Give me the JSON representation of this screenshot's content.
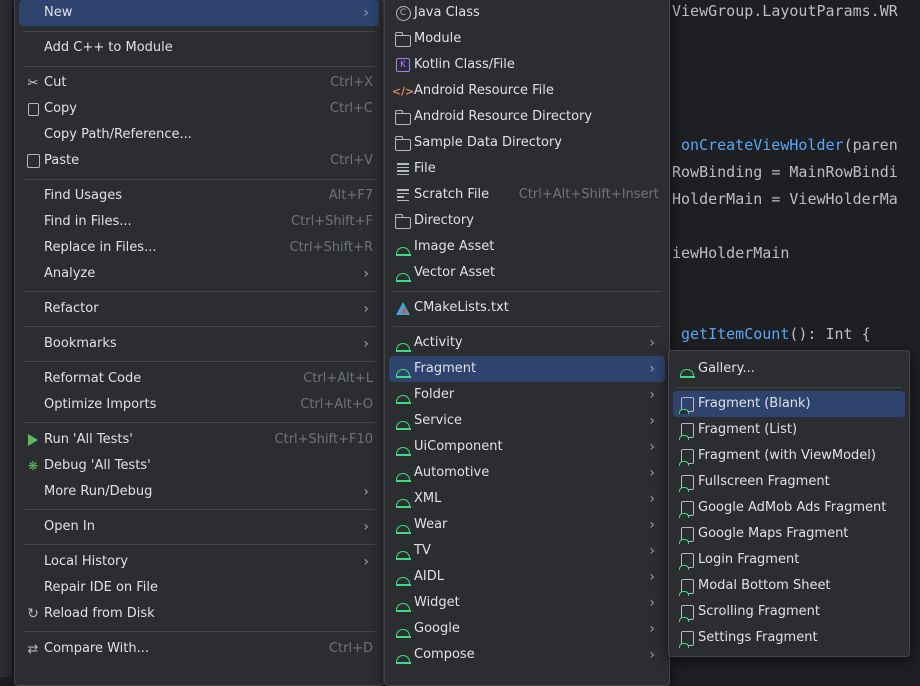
{
  "editor": {
    "lines": [
      {
        "text": "ViewGroup.LayoutParams.WR",
        "fn": ""
      },
      {
        "text": "",
        "fn": "onCreateViewHolder",
        "suffix": "(paren"
      },
      {
        "text": "RowBinding = MainRowBindi",
        "fn": ""
      },
      {
        "text": "HolderMain = ViewHolderMa",
        "fn": ""
      },
      {
        "text": "iewHolderMain",
        "fn": ""
      },
      {
        "text": "",
        "fn": "getItemCount",
        "suffix": "(): Int {"
      }
    ]
  },
  "context_menu": {
    "items": [
      {
        "label": "New",
        "submenu": true,
        "selected": true
      },
      {
        "label": "Add C++ to Module"
      },
      {
        "label": "Cut",
        "shortcut": "Ctrl+X",
        "icon": "scissors-icon"
      },
      {
        "label": "Copy",
        "shortcut": "Ctrl+C",
        "icon": "copy-icon"
      },
      {
        "label": "Copy Path/Reference..."
      },
      {
        "label": "Paste",
        "shortcut": "Ctrl+V",
        "icon": "paste-icon"
      },
      {
        "label": "Find Usages",
        "shortcut": "Alt+F7"
      },
      {
        "label": "Find in Files...",
        "shortcut": "Ctrl+Shift+F"
      },
      {
        "label": "Replace in Files...",
        "shortcut": "Ctrl+Shift+R"
      },
      {
        "label": "Analyze",
        "submenu": true
      },
      {
        "label": "Refactor",
        "submenu": true
      },
      {
        "label": "Bookmarks",
        "submenu": true
      },
      {
        "label": "Reformat Code",
        "shortcut": "Ctrl+Alt+L"
      },
      {
        "label": "Optimize Imports",
        "shortcut": "Ctrl+Alt+O"
      },
      {
        "label": "Run 'All Tests'",
        "shortcut": "Ctrl+Shift+F10",
        "icon": "run-icon"
      },
      {
        "label": "Debug 'All Tests'",
        "icon": "debug-icon"
      },
      {
        "label": "More Run/Debug",
        "submenu": true
      },
      {
        "label": "Open In",
        "submenu": true
      },
      {
        "label": "Local History",
        "submenu": true
      },
      {
        "label": "Repair IDE on File"
      },
      {
        "label": "Reload from Disk",
        "icon": "reload-icon"
      },
      {
        "label": "Compare With...",
        "shortcut": "Ctrl+D",
        "icon": "compare-icon"
      }
    ]
  },
  "new_menu": {
    "items": [
      {
        "label": "Java Class",
        "icon": "java-class-icon"
      },
      {
        "label": "Module",
        "icon": "folder-icon"
      },
      {
        "label": "Kotlin Class/File",
        "icon": "kotlin-icon"
      },
      {
        "label": "Android Resource File",
        "icon": "code-icon"
      },
      {
        "label": "Android Resource Directory",
        "icon": "folder-icon"
      },
      {
        "label": "Sample Data Directory",
        "icon": "folder-icon"
      },
      {
        "label": "File",
        "icon": "file-icon"
      },
      {
        "label": "Scratch File",
        "shortcut": "Ctrl+Alt+Shift+Insert",
        "icon": "scratch-file-icon"
      },
      {
        "label": "Directory",
        "icon": "folder-icon"
      },
      {
        "label": "Image Asset",
        "icon": "android-icon"
      },
      {
        "label": "Vector Asset",
        "icon": "android-icon"
      },
      {
        "label": "CMakeLists.txt",
        "icon": "cmake-icon"
      },
      {
        "label": "Activity",
        "icon": "android-icon",
        "submenu": true
      },
      {
        "label": "Fragment",
        "icon": "android-icon",
        "submenu": true,
        "selected": true
      },
      {
        "label": "Folder",
        "icon": "android-icon",
        "submenu": true
      },
      {
        "label": "Service",
        "icon": "android-icon",
        "submenu": true
      },
      {
        "label": "UiComponent",
        "icon": "android-icon",
        "submenu": true
      },
      {
        "label": "Automotive",
        "icon": "android-icon",
        "submenu": true
      },
      {
        "label": "XML",
        "icon": "android-icon",
        "submenu": true
      },
      {
        "label": "Wear",
        "icon": "android-icon",
        "submenu": true
      },
      {
        "label": "TV",
        "icon": "android-icon",
        "submenu": true
      },
      {
        "label": "AIDL",
        "icon": "android-icon",
        "submenu": true
      },
      {
        "label": "Widget",
        "icon": "android-icon",
        "submenu": true
      },
      {
        "label": "Google",
        "icon": "android-icon",
        "submenu": true
      },
      {
        "label": "Compose",
        "icon": "android-icon",
        "submenu": true
      }
    ]
  },
  "fragment_menu": {
    "items": [
      {
        "label": "Gallery...",
        "icon": "android-icon"
      },
      {
        "label": "Fragment (Blank)",
        "icon": "fragment-icon",
        "selected": true
      },
      {
        "label": "Fragment (List)",
        "icon": "fragment-icon"
      },
      {
        "label": "Fragment (with ViewModel)",
        "icon": "fragment-icon"
      },
      {
        "label": "Fullscreen Fragment",
        "icon": "fragment-icon"
      },
      {
        "label": "Google AdMob Ads Fragment",
        "icon": "fragment-icon"
      },
      {
        "label": "Google Maps Fragment",
        "icon": "fragment-icon"
      },
      {
        "label": "Login Fragment",
        "icon": "fragment-icon"
      },
      {
        "label": "Modal Bottom Sheet",
        "icon": "fragment-icon"
      },
      {
        "label": "Scrolling Fragment",
        "icon": "fragment-icon"
      },
      {
        "label": "Settings Fragment",
        "icon": "fragment-icon"
      }
    ]
  }
}
